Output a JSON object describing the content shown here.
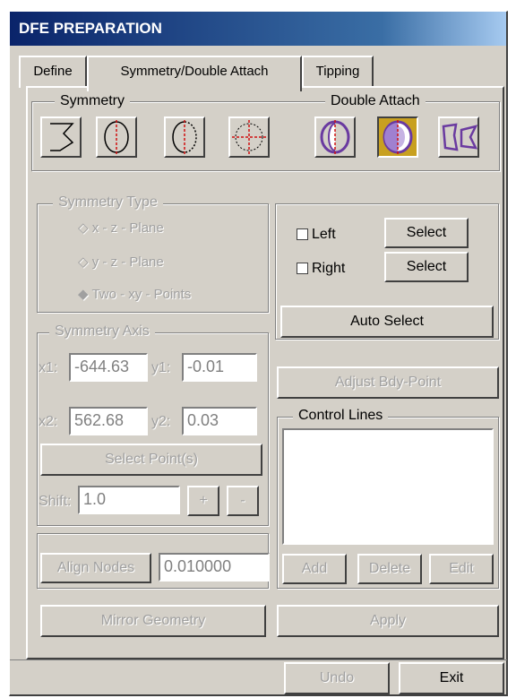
{
  "window": {
    "title": "DFE PREPARATION"
  },
  "tabs": [
    {
      "label": "Define"
    },
    {
      "label": "Symmetry/Double Attach"
    },
    {
      "label": "Tipping"
    }
  ],
  "symmetry_group": {
    "label": "Symmetry"
  },
  "double_attach_group": {
    "label": "Double Attach"
  },
  "icons": {
    "sym1": "zigzag-edge-icon",
    "sym2": "circle-vertical-axis-icon",
    "sym3": "circle-dashed-half-icon",
    "sym4": "circle-crosshair-icon",
    "da1": "double-attach-split-icon",
    "da2": "double-attach-filled-icon",
    "da3": "double-attach-shapes-icon"
  },
  "symmetry_type": {
    "label": "Symmetry Type",
    "options": [
      "x - z - Plane",
      "y - z - Plane",
      "Two - xy - Points"
    ],
    "selected": "Two - xy - Points"
  },
  "symmetry_axis": {
    "label": "Symmetry Axis",
    "x1_label": "x1:",
    "x1": "-644.63",
    "y1_label": "y1:",
    "y1": "-0.01",
    "x2_label": "x2:",
    "x2": "562.68",
    "y2_label": "y2:",
    "y2": "0.03",
    "select_points": "Select  Point(s)",
    "shift_label": "Shift:",
    "shift": "1.0",
    "plus": "+",
    "minus": "-"
  },
  "align": {
    "button": "Align Nodes",
    "value": "0.010000"
  },
  "mirror_geometry": "Mirror Geometry",
  "double_attach": {
    "left_label": "Left",
    "right_label": "Right",
    "select": "Select",
    "auto_select": "Auto Select",
    "adjust_bdy": "Adjust Bdy-Point"
  },
  "control_lines": {
    "label": "Control Lines",
    "add": "Add",
    "delete": "Delete",
    "edit": "Edit"
  },
  "apply": "Apply",
  "footer": {
    "undo": "Undo",
    "exit": "Exit"
  },
  "colors": {
    "title_bar": "#0a246a",
    "pressed": "#c8a020",
    "icon_purple": "#6a3aa0",
    "icon_red": "#d01010"
  }
}
